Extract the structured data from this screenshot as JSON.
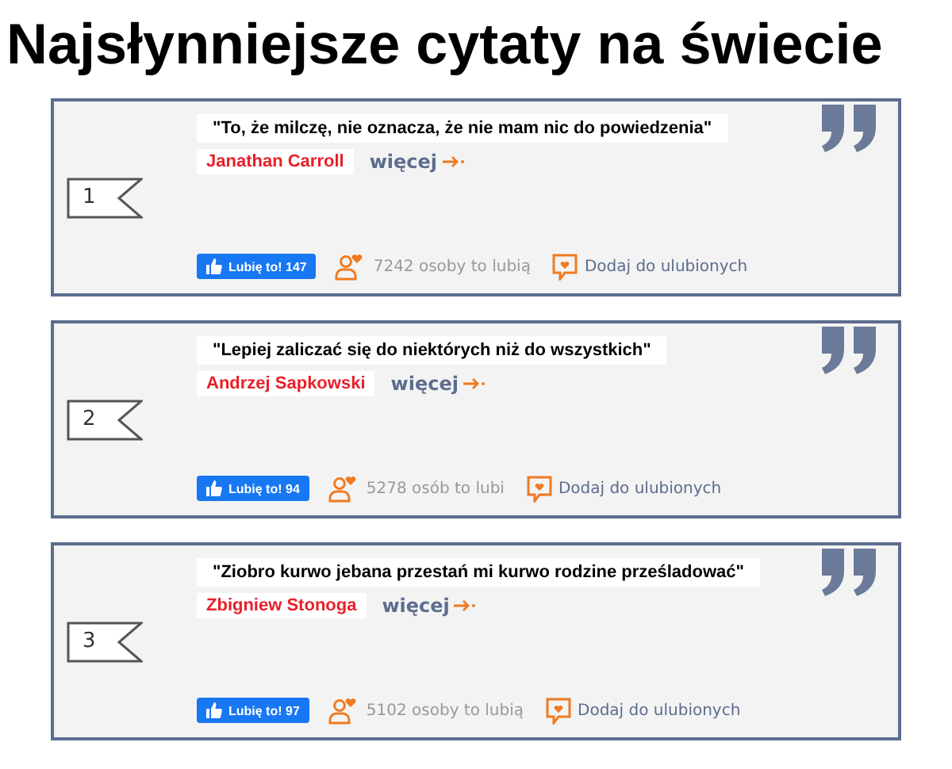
{
  "title": "Najsłynniejsze cytaty na świecie",
  "quotes": [
    {
      "number": "1",
      "text": "\"To, że milczę, nie oznacza, że nie mam nic do powiedzenia\"",
      "author": "Janathan Carroll",
      "more": "więcej",
      "like_button": "Lubię to! 147",
      "likes": "7242 osoby to lubią",
      "favorite": "Dodaj do ulubionych"
    },
    {
      "number": "2",
      "text": "\"Lepiej zaliczać się do niektórych niż do wszystkich\"",
      "author": "Andrzej Sapkowski",
      "more": "więcej",
      "like_button": "Lubię to! 94",
      "likes": "5278 osób to lubi",
      "favorite": "Dodaj do ulubionych"
    },
    {
      "number": "3",
      "text": "\"Ziobro kurwo jebana przestań mi kurwo rodzine prześladować\"",
      "author": "Zbigniew Stonoga",
      "more": "więcej",
      "like_button": "Lubię to! 97",
      "likes": "5102 osoby to lubią",
      "favorite": "Dodaj do ulubionych"
    }
  ]
}
